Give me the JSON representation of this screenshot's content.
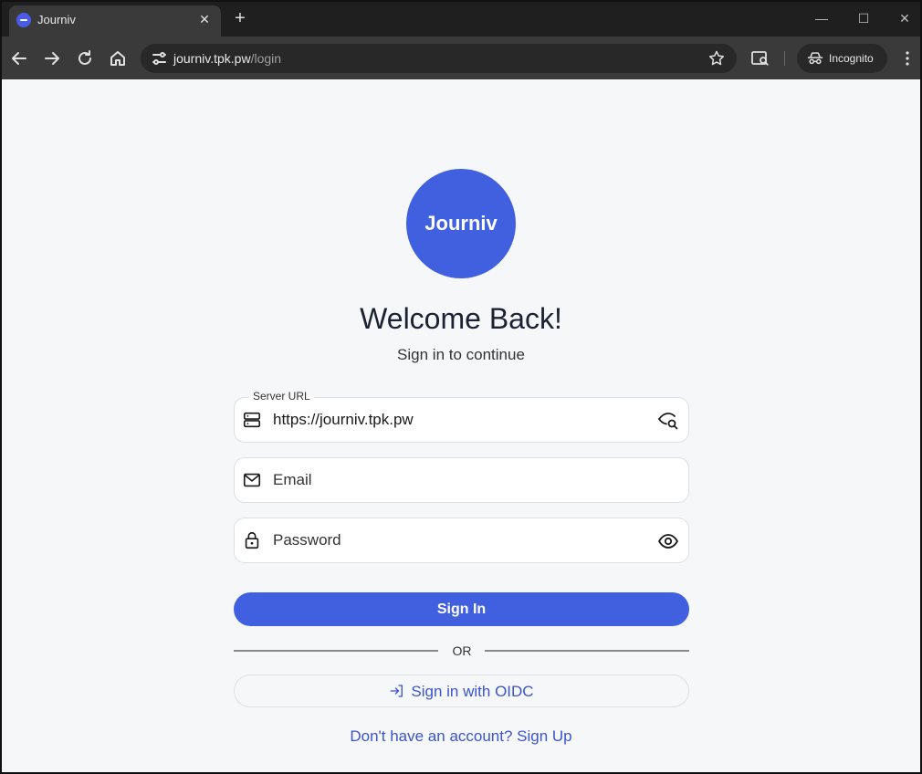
{
  "browser": {
    "tab_title": "Journiv",
    "url_host": "journiv.tpk.pw",
    "url_path": "/login",
    "incognito_label": "Incognito"
  },
  "icons": {
    "tab_close": "close-icon",
    "new_tab": "plus-icon",
    "back": "arrow-left-icon",
    "forward": "arrow-right-icon",
    "reload": "reload-icon",
    "home": "home-icon",
    "site_info": "tune-icon",
    "bookmark": "star-icon",
    "lens": "lens-icon",
    "incognito": "incognito-icon",
    "menu": "kebab-icon"
  },
  "login": {
    "logo_text": "Journiv",
    "title": "Welcome Back!",
    "subtitle": "Sign in to continue",
    "server_url": {
      "label": "Server URL",
      "value": "https://journiv.tpk.pw"
    },
    "email": {
      "placeholder": "Email",
      "value": ""
    },
    "password": {
      "placeholder": "Password",
      "value": ""
    },
    "signin_label": "Sign In",
    "or_label": "OR",
    "oidc_label": "Sign in with OIDC",
    "signup_label": "Don't have an account? Sign Up"
  },
  "colors": {
    "accent": "#4060e0",
    "link": "#3a55d0",
    "page_bg": "#f6f7f9"
  }
}
